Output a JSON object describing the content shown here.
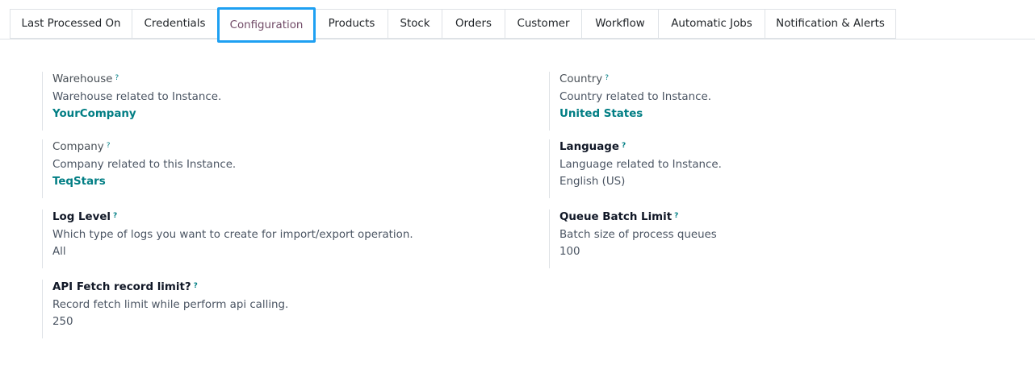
{
  "tabs": [
    {
      "label": "Last Processed On"
    },
    {
      "label": "Credentials"
    },
    {
      "label": "Configuration"
    },
    {
      "label": "Products"
    },
    {
      "label": "Stock"
    },
    {
      "label": "Orders"
    },
    {
      "label": "Customer"
    },
    {
      "label": "Workflow"
    },
    {
      "label": "Automatic Jobs"
    },
    {
      "label": "Notification & Alerts"
    }
  ],
  "help_mark": "?",
  "fields": {
    "warehouse": {
      "label": "Warehouse",
      "description": "Warehouse related to Instance.",
      "value": "YourCompany"
    },
    "company": {
      "label": "Company",
      "description": "Company related to this Instance.",
      "value": "TeqStars"
    },
    "log_level": {
      "label": "Log Level",
      "description": "Which type of logs you want to create for import/export operation.",
      "value": "All"
    },
    "api_fetch_limit": {
      "label": "API Fetch record limit?",
      "description": "Record fetch limit while perform api calling.",
      "value": "250"
    },
    "country": {
      "label": "Country",
      "description": "Country related to Instance.",
      "value": "United States"
    },
    "language": {
      "label": "Language",
      "description": "Language related to Instance.",
      "value": "English (US)"
    },
    "queue_batch_limit": {
      "label": "Queue Batch Limit",
      "description": "Batch size of process queues",
      "value": "100"
    }
  },
  "colors": {
    "accent_link": "#017e84",
    "active_tab_text": "#714B67",
    "active_tab_outline": "#1ea0f2"
  }
}
